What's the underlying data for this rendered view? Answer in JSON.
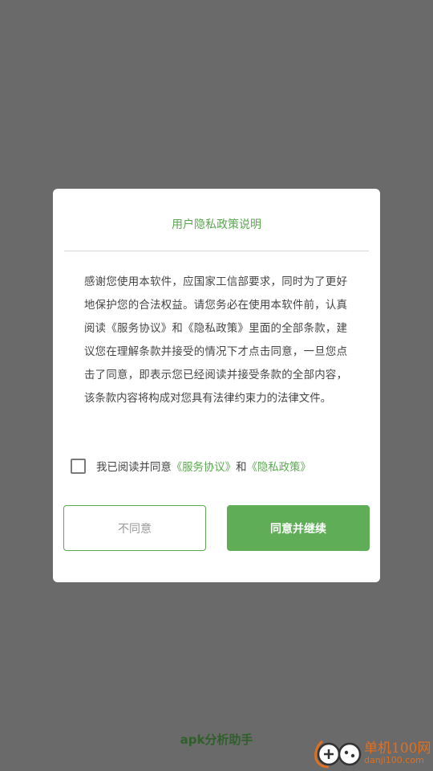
{
  "dialog": {
    "title": "用户隐私政策说明",
    "body": "感谢您使用本软件，应国家工信部要求，同时为了更好地保护您的合法权益。请您务必在使用本软件前，认真阅读《服务协议》和《隐私政策》里面的全部条款，建议您在理解条款并接受的情况下才点击同意，一旦您点击了同意，即表示您已经阅读并接受条款的全部内容，该条款内容将构成对您具有法律约束力的法律文件。",
    "agree_prefix": "我已阅读并同意",
    "service_link": "《服务协议》",
    "and_text": "和",
    "privacy_link": "《隐私政策》",
    "checkbox_checked": false,
    "disagree_label": "不同意",
    "agree_label": "同意并继续"
  },
  "footer": {
    "label": "apk分析助手"
  },
  "watermark": {
    "title": "单机100网",
    "url": "danji100.com"
  },
  "colors": {
    "accent": "#5aa84f",
    "overlay": "#6a6a6a",
    "watermark": "#e07020"
  }
}
